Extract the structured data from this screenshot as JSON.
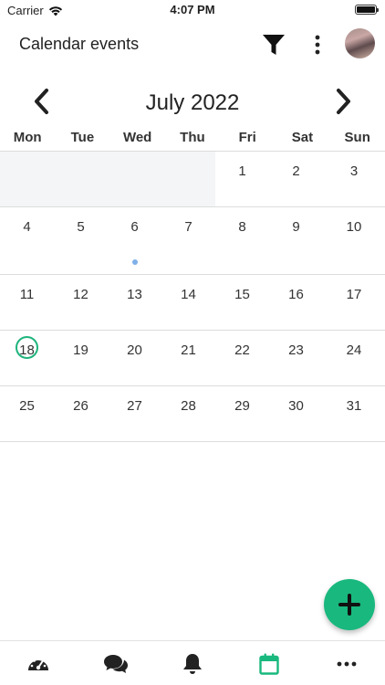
{
  "status_bar": {
    "carrier": "Carrier",
    "time": "4:07 PM"
  },
  "header": {
    "title": "Calendar events"
  },
  "calendar": {
    "month_label": "July 2022",
    "weekdays": [
      "Mon",
      "Tue",
      "Wed",
      "Thu",
      "Fri",
      "Sat",
      "Sun"
    ],
    "weeks": [
      [
        "",
        "",
        "",
        "",
        "1",
        "2",
        "3"
      ],
      [
        "4",
        "5",
        "6",
        "7",
        "8",
        "9",
        "10"
      ],
      [
        "11",
        "12",
        "13",
        "14",
        "15",
        "16",
        "17"
      ],
      [
        "18",
        "19",
        "20",
        "21",
        "22",
        "23",
        "24"
      ],
      [
        "25",
        "26",
        "27",
        "28",
        "29",
        "30",
        "31"
      ]
    ],
    "today": "18",
    "event_days": [
      "6"
    ]
  },
  "tabs": [
    {
      "icon": "dashboard-icon",
      "active": false
    },
    {
      "icon": "chat-icon",
      "active": false
    },
    {
      "icon": "bell-icon",
      "active": false
    },
    {
      "icon": "calendar-icon",
      "active": true
    },
    {
      "icon": "more-horizontal-icon",
      "active": false
    }
  ],
  "colors": {
    "accent": "#19b87e",
    "event_dot": "#7fb0e8",
    "empty_cell": "#f4f5f7"
  }
}
